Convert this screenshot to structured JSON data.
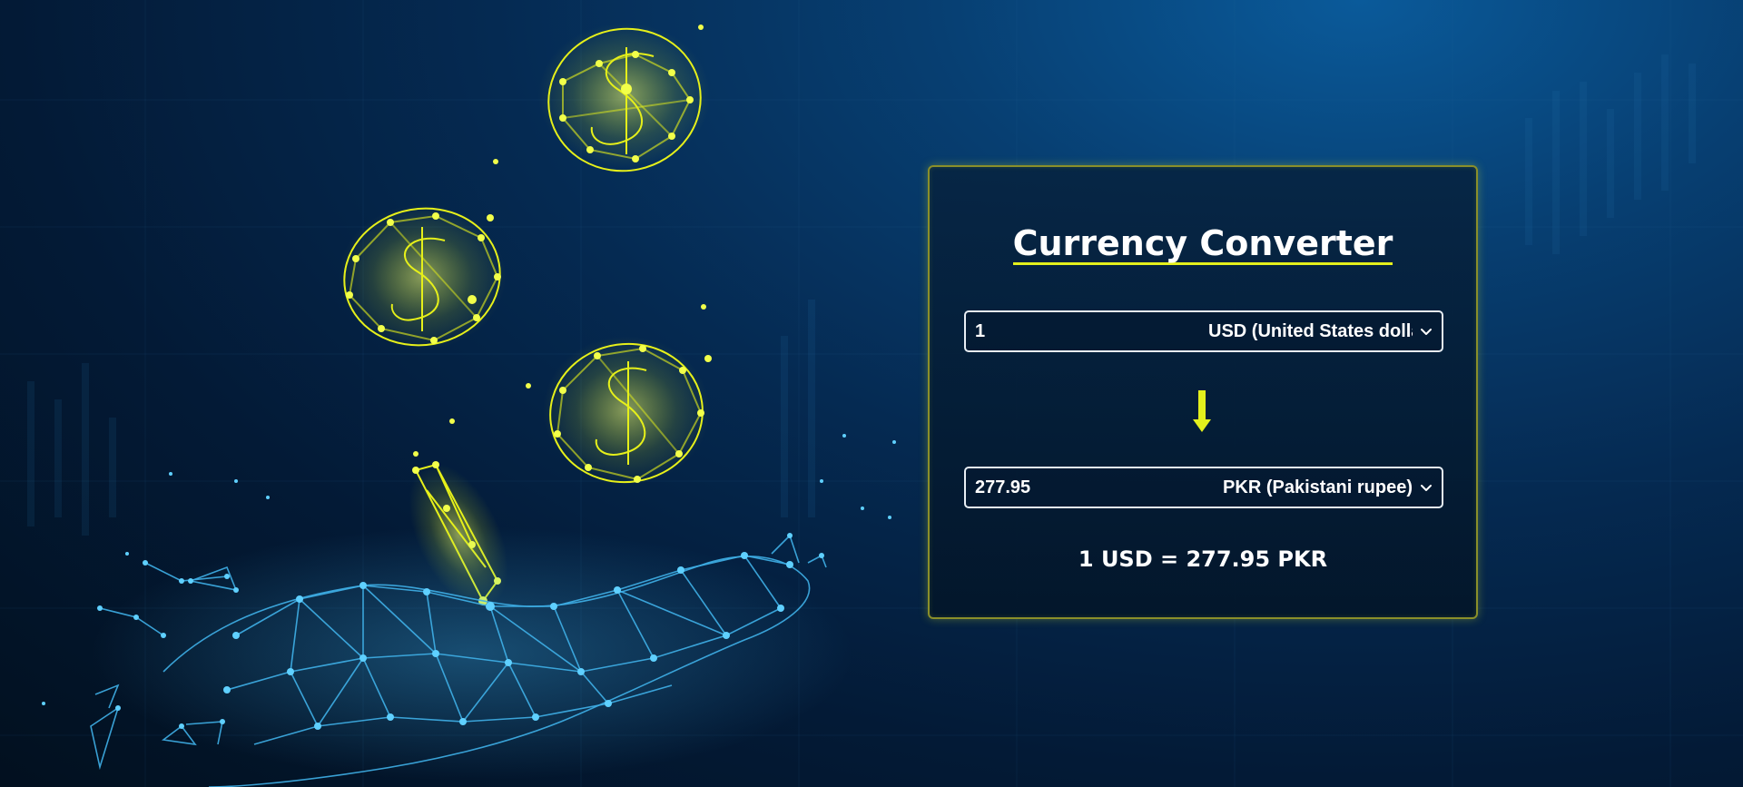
{
  "app": {
    "title": "Currency Converter"
  },
  "from": {
    "amount": "1",
    "currency_label": "USD (United States dollar)",
    "icon": "chevron-down-icon"
  },
  "swap_indicator": {
    "icon": "arrow-down-icon",
    "color": "#e4f01c"
  },
  "to": {
    "amount": "277.95",
    "currency_label": "PKR (Pakistani rupee)",
    "icon": "chevron-down-icon"
  },
  "rate_text": "1 USD = 277.95 PKR",
  "theme": {
    "accent": "#e4f01c",
    "background": "#03203f",
    "card_border": "#8a8f2a",
    "text": "#ffffff",
    "hand_color": "#3fb0e8",
    "coin_color": "#e6f01a"
  }
}
